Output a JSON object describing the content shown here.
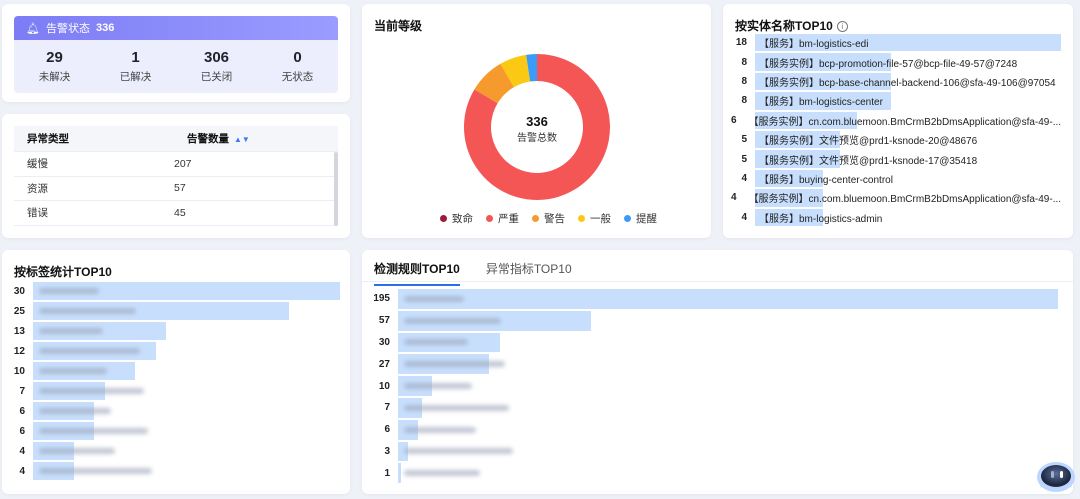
{
  "alert_status": {
    "title": "告警状态",
    "total": "336",
    "items": [
      {
        "value": "29",
        "label": "未解决"
      },
      {
        "value": "1",
        "label": "已解决"
      },
      {
        "value": "306",
        "label": "已关闭"
      },
      {
        "value": "0",
        "label": "无状态"
      }
    ]
  },
  "type_table": {
    "headers": [
      "异常类型",
      "告警数量"
    ],
    "rows": [
      [
        "缓慢",
        "207"
      ],
      [
        "资源",
        "57"
      ],
      [
        "错误",
        "45"
      ]
    ]
  },
  "level": {
    "title": "当前等级",
    "center_value": "336",
    "center_label": "告警总数"
  },
  "chart_data": [
    {
      "type": "pie",
      "title": "当前等级",
      "categories": [
        "致命",
        "严重",
        "警告",
        "一般",
        "提醒"
      ],
      "values": [
        0,
        281,
        27,
        20,
        8
      ],
      "colors": [
        "#9b1b3a",
        "#f45555",
        "#f79a2e",
        "#fbc913",
        "#3a9bf8"
      ],
      "legend": "bottom"
    },
    {
      "type": "bar",
      "title": "按实体名称TOP10",
      "categories": [
        "【服务】bm-logistics-edi",
        "【服务实例】bcp-promotion-file-57@bcp-file-49-57@7248",
        "【服务实例】bcp-base-channel-backend-106@sfa-49-106@97054",
        "【服务】bm-logistics-center",
        "【服务实例】cn.com.bluemoon.BmCrmB2bDmsApplication@sfa-49-...",
        "【服务实例】文件预览@prd1-ksnode-20@48676",
        "【服务实例】文件预览@prd1-ksnode-17@35418",
        "【服务】buying-center-control",
        "【服务实例】cn.com.bluemoon.BmCrmB2bDmsApplication@sfa-49-...",
        "【服务】bm-logistics-admin"
      ],
      "values": [
        18,
        8,
        8,
        8,
        6,
        5,
        5,
        4,
        4,
        4
      ]
    },
    {
      "type": "bar",
      "title": "按标签统计TOP10",
      "values": [
        30,
        25,
        13,
        12,
        10,
        7,
        6,
        6,
        4,
        4
      ]
    },
    {
      "type": "bar",
      "title": "检测规则TOP10",
      "values": [
        195,
        57,
        30,
        27,
        10,
        7,
        6,
        3,
        1
      ]
    }
  ],
  "tabs": [
    "检测规则TOP10",
    "异常指标TOP10"
  ]
}
